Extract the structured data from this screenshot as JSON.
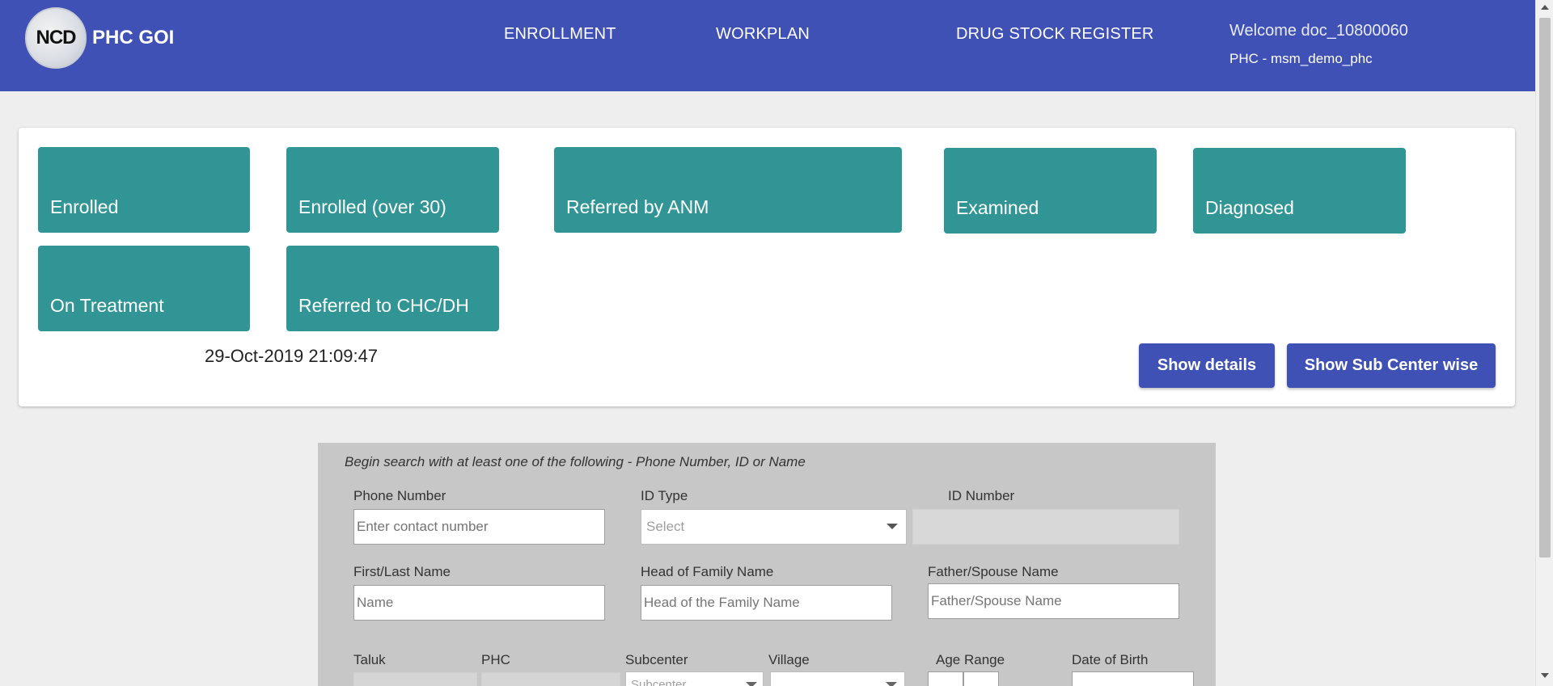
{
  "header": {
    "logo_text": "NCD",
    "app_title": "PHC GOI",
    "nav": [
      "ENROLLMENT",
      "WORKPLAN",
      "DRUG STOCK REGISTER"
    ],
    "welcome": "Welcome doc_10800060",
    "phc": "PHC - msm_demo_phc",
    "bg_color": "#3f51b5"
  },
  "dashboard": {
    "tiles": [
      "Enrolled",
      "Enrolled (over 30)",
      "Referred by ANM",
      "Examined",
      "Diagnosed",
      "On Treatment",
      "Referred to CHC/DH"
    ],
    "tile_color": "#329595",
    "timestamp": "29-Oct-2019 21:09:47",
    "show_details_label": "Show details",
    "show_subcenter_label": "Show Sub Center wise"
  },
  "search": {
    "hint": "Begin search with at least one of the following - Phone Number, ID or Name",
    "phone_label": "Phone Number",
    "phone_placeholder": "Enter contact number",
    "id_type_label": "ID Type",
    "id_type_value": "Select",
    "id_number_label": "ID Number",
    "name_label": "First/Last Name",
    "name_placeholder": "Name",
    "hof_label": "Head of Family Name",
    "hof_placeholder": "Head of the Family Name",
    "father_label": "Father/Spouse Name",
    "father_placeholder": "Father/Spouse Name",
    "taluk_label": "Taluk",
    "phc_label": "PHC",
    "subcenter_label": "Subcenter",
    "subcenter_value": "Subcenter",
    "village_label": "Village",
    "age_label": "Age Range",
    "dob_label": "Date of Birth"
  }
}
